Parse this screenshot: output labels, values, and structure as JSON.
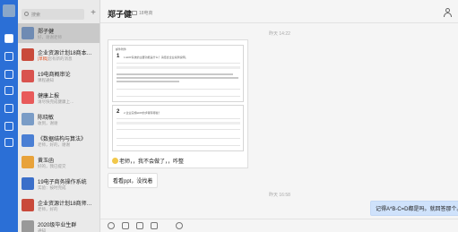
{
  "rail": {
    "items": [
      "chat-icon",
      "docs-icon",
      "mail-icon",
      "apps-icon",
      "calendar-icon",
      "drive-icon",
      "settings-icon"
    ]
  },
  "search": {
    "placeholder": "搜索"
  },
  "conversations": [
    {
      "name": "郑子健",
      "preview": "好，谢谢老师",
      "tag": "",
      "color": "#6f8bb3"
    },
    {
      "name": "企业资源计划18商本…",
      "preview": "您有新的消息",
      "tag": "[草稿]",
      "color": "#c94a3b"
    },
    {
      "name": "19电商概审论",
      "preview": "课程通知",
      "tag": "",
      "color": "#d9534f"
    },
    {
      "name": "健康上报",
      "preview": "请尽快完成健康上…",
      "tag": "",
      "color": "#e85a5a"
    },
    {
      "name": "陈晓敏",
      "preview": "收到，谢谢",
      "tag": "",
      "color": "#7a9cc6"
    },
    {
      "name": "《数据结构与算法》",
      "preview": "老师，好的，谢谢",
      "tag": "",
      "color": "#4a7fd4"
    },
    {
      "name": "黄玉函",
      "preview": "好的，我已提交",
      "tag": "",
      "color": "#e8a23a"
    },
    {
      "name": "19电子商务操作系统",
      "preview": "实验：按时完成",
      "tag": "",
      "color": "#3b6fc9"
    },
    {
      "name": "企业资源计划18商师…",
      "preview": "老师，好的",
      "tag": "",
      "color": "#c94a3b"
    },
    {
      "name": "2020级毕业生群",
      "preview": "通知",
      "tag": "",
      "color": "#999999"
    }
  ],
  "header": {
    "title": "郑子健",
    "org": "18电商"
  },
  "messages": {
    "time1": "昨天 14:22",
    "card": {
      "file_label": "邮件附件",
      "q1_no": "1",
      "q1_text": "1.ERP系统的主要功能是什么？请结合企业案例说明。",
      "q2_no": "2",
      "q2_text": "2.企业实施ERP的步骤有哪些？",
      "caption": "老师，，我不会做了，，咋整"
    },
    "reply": "看看ppt，没找着",
    "time2": "昨天 16:58",
    "mine": "记得A*B-C=D都是吗。就回答那个。"
  },
  "composer": {
    "tools": [
      "emoji-icon",
      "scissors-icon",
      "folder-icon",
      "image-icon",
      "phone-icon"
    ]
  }
}
